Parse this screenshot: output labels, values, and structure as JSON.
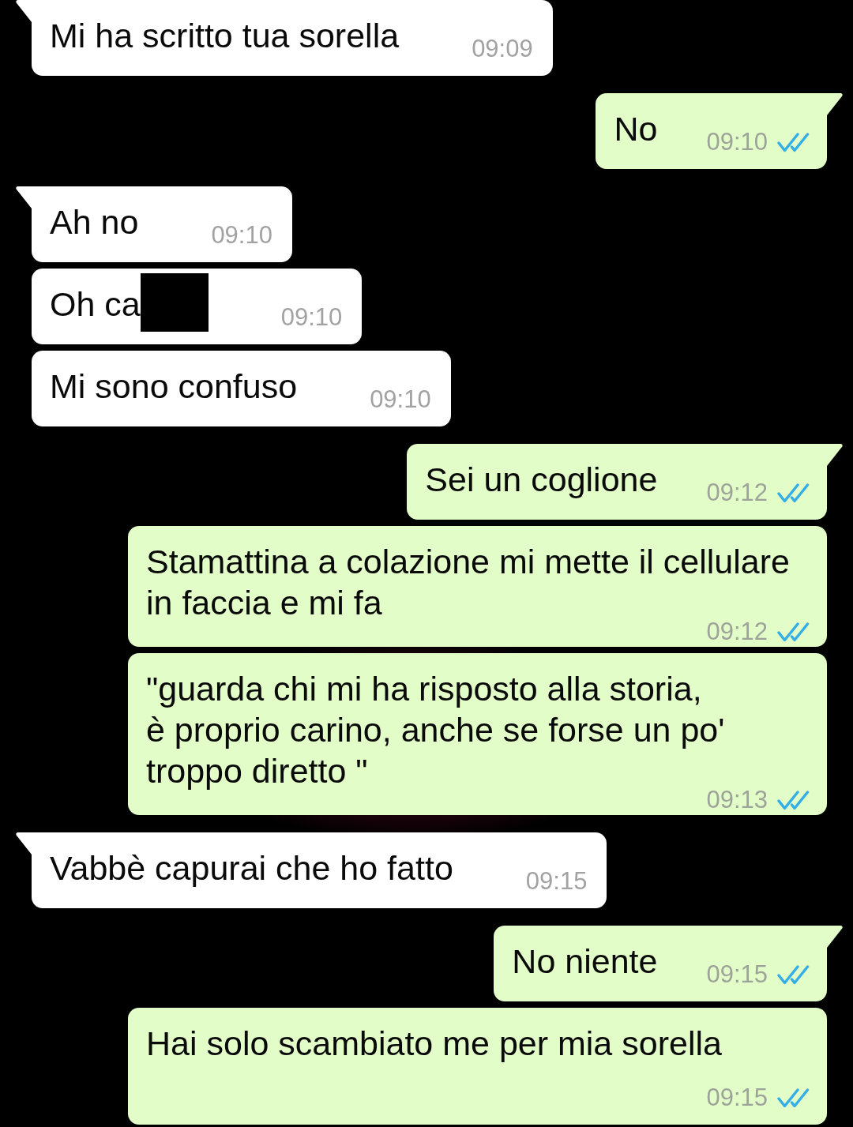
{
  "messages": [
    {
      "kind": "incoming",
      "tail": true,
      "text": "Mi ha scritto tua sorella",
      "redacted": false,
      "time": "09:09"
    },
    {
      "kind": "outgoing",
      "tail": true,
      "text": "No",
      "redacted": false,
      "time": "09:10",
      "read": true
    },
    {
      "kind": "incoming",
      "tail": true,
      "text": "Ah no",
      "redacted": false,
      "time": "09:10"
    },
    {
      "kind": "incoming",
      "tail": false,
      "text": "Oh ca",
      "redacted": true,
      "time": "09:10"
    },
    {
      "kind": "incoming",
      "tail": false,
      "text": "Mi sono confuso",
      "redacted": false,
      "time": "09:10"
    },
    {
      "kind": "outgoing",
      "tail": true,
      "text": "Sei un coglione",
      "redacted": false,
      "time": "09:12",
      "read": true
    },
    {
      "kind": "outgoing",
      "tail": false,
      "text": "Stamattina a colazione mi mette il cellulare in faccia e mi fa",
      "redacted": false,
      "time": "09:12",
      "read": true
    },
    {
      "kind": "outgoing",
      "tail": false,
      "text": "\"guarda chi mi ha risposto alla storia,\nè proprio carino, anche se forse un po' troppo diretto \"",
      "redacted": false,
      "time": "09:13",
      "read": true
    },
    {
      "kind": "incoming",
      "tail": true,
      "text": "Vabbè capurai che ho fatto",
      "redacted": false,
      "time": "09:15"
    },
    {
      "kind": "outgoing",
      "tail": true,
      "text": "No niente",
      "redacted": false,
      "time": "09:15",
      "read": true
    },
    {
      "kind": "outgoing",
      "tail": false,
      "text": "Hai solo scambiato me per mia sorella",
      "redacted": false,
      "time": "09:15",
      "read": true
    }
  ]
}
